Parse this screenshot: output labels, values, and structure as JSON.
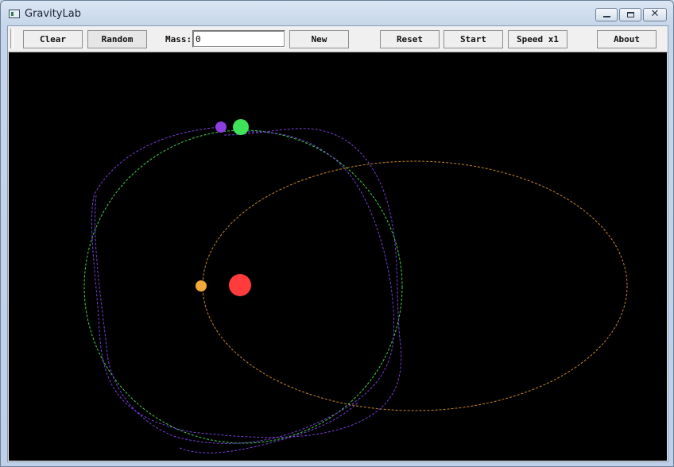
{
  "window": {
    "title": "GravityLab"
  },
  "toolbar": {
    "clear_label": "Clear",
    "random_label": "Random",
    "mass_label": "Mass:",
    "mass_value": "0",
    "new_label": "New",
    "reset_label": "Reset",
    "start_label": "Start",
    "speed_label": "Speed x1",
    "about_label": "About"
  },
  "colors": {
    "canvas_bg": "#000000",
    "sun": "#ff3b3b",
    "green_body": "#3fe35a",
    "purple_body": "#8b3fe0",
    "orange_body": "#f3a93a",
    "green_trail": "#3fd44f",
    "purple_trail": "#7a3ed9",
    "orange_trail": "#c8862f"
  },
  "icons": [
    "app-icon",
    "minimize-icon",
    "maximize-icon",
    "close-icon"
  ]
}
